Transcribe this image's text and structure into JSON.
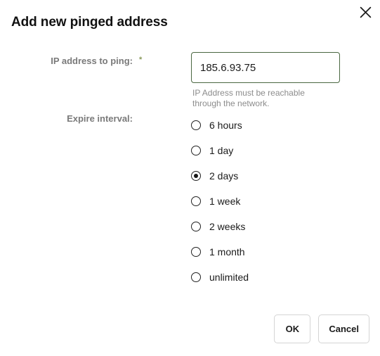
{
  "dialog": {
    "title": "Add new pinged address",
    "close_icon": "close-icon"
  },
  "fields": {
    "ip": {
      "label": "IP address to ping:",
      "required_marker": "*",
      "value": "185.6.93.75",
      "placeholder": "",
      "helper_text": "IP Address must be reachable through the network."
    },
    "expire": {
      "label": "Expire interval:",
      "selected": "2 days",
      "options": [
        {
          "label": "6 hours",
          "selected": false
        },
        {
          "label": "1 day",
          "selected": false
        },
        {
          "label": "2 days",
          "selected": true
        },
        {
          "label": "1 week",
          "selected": false
        },
        {
          "label": "2 weeks",
          "selected": false
        },
        {
          "label": "1 month",
          "selected": false
        },
        {
          "label": "unlimited",
          "selected": false
        }
      ]
    }
  },
  "footer": {
    "ok_label": "OK",
    "cancel_label": "Cancel"
  },
  "colors": {
    "input_border": "#4a6741",
    "required_star": "#8a9a5b",
    "label_text": "#7a7a7a",
    "helper_text": "#8c8c8c",
    "title_text": "#111111"
  }
}
